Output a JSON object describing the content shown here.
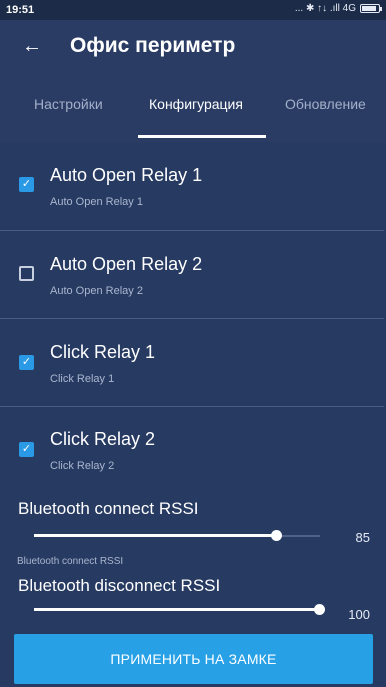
{
  "status_bar": {
    "time": "19:51",
    "icons_text": "... ✱ ↑↓ .ıll 4G",
    "battery_level": 0.9
  },
  "app_bar": {
    "back_icon": "arrow-left-icon",
    "title": "Офис периметр"
  },
  "tabs": [
    {
      "label": "Настройки",
      "active": false
    },
    {
      "label": "Конфигурация",
      "active": true
    },
    {
      "label": "Обновление",
      "active": false
    }
  ],
  "settings": [
    {
      "title": "Auto Open Relay 1",
      "subtitle": "Auto Open Relay 1",
      "checked": true
    },
    {
      "title": "Auto Open Relay 2",
      "subtitle": "Auto Open Relay 2",
      "checked": false
    },
    {
      "title": "Click Relay 1",
      "subtitle": "Click Relay 1",
      "checked": true
    },
    {
      "title": "Click Relay 2",
      "subtitle": "Click Relay 2",
      "checked": true
    }
  ],
  "rssi": {
    "connect": {
      "title": "Bluetooth connect RSSI",
      "value": "85",
      "level": 0.85,
      "caption": "Bluetooth connect RSSI"
    },
    "disconnect": {
      "title": "Bluetooth disconnect RSSI",
      "value": "100",
      "level": 1.0
    }
  },
  "apply_button": {
    "label": "ПРИМЕНИТЬ НА ЗАМКЕ"
  },
  "colors": {
    "background": "#273a62",
    "header": "#2a3c64",
    "accent": "#27a0e6",
    "checkbox": "#2b9ae6"
  }
}
